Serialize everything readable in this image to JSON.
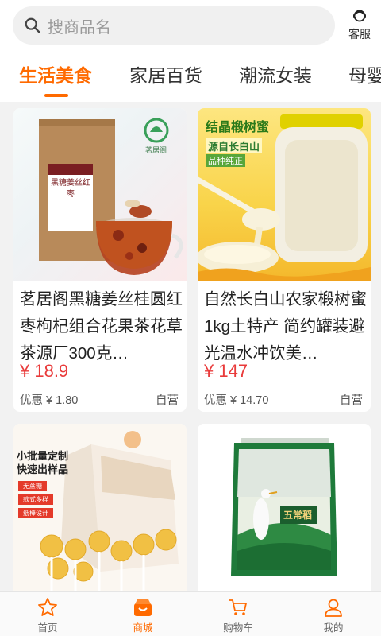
{
  "search": {
    "placeholder": "搜商品名",
    "service_label": "客服"
  },
  "tabs": [
    {
      "label": "生活美食",
      "active": true
    },
    {
      "label": "家居百货",
      "active": false
    },
    {
      "label": "潮流女装",
      "active": false
    },
    {
      "label": "母婴",
      "active": false
    }
  ],
  "products": [
    {
      "title": "茗居阁黑糖姜丝桂圆红枣枸杞组合花果茶花草茶源厂300克…",
      "price": "¥ 18.9",
      "discount": "优惠 ¥ 1.80",
      "tag": "自营",
      "image": {
        "brand": "茗居阁",
        "package_text": "黑糖姜丝红枣"
      }
    },
    {
      "title": "自然长白山农家椴树蜜1kg土特产 简约罐装避光温水冲饮美…",
      "price": "¥ 147",
      "discount": "优惠 ¥ 14.70",
      "tag": "自营",
      "image": {
        "headline": "结晶椴树蜜",
        "sub1": "源自长白山",
        "sub2": "品种纯正"
      }
    },
    {
      "image": {
        "headline1": "小批量定制",
        "headline2": "快速出样品",
        "tags": [
          "无蔗糖",
          "款式多样",
          "纸棒设计"
        ]
      }
    },
    {
      "image": {
        "brand": "五常稻"
      }
    }
  ],
  "nav": [
    {
      "label": "首页",
      "icon": "star-icon",
      "active": false
    },
    {
      "label": "商城",
      "icon": "shop-icon",
      "active": true
    },
    {
      "label": "购物车",
      "icon": "cart-icon",
      "active": false
    },
    {
      "label": "我的",
      "icon": "user-icon",
      "active": false
    }
  ],
  "colors": {
    "accent": "#ff6a00",
    "price": "#e93b3b"
  }
}
